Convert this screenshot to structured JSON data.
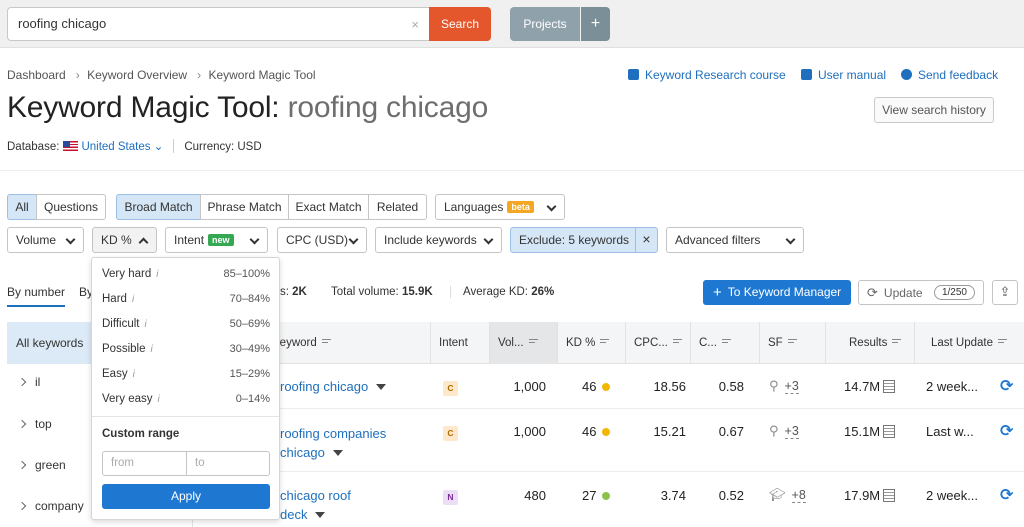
{
  "search": {
    "value": "roofing chicago",
    "clear": "×",
    "button": "Search"
  },
  "projects": {
    "label": "Projects",
    "plus": "+"
  },
  "breadcrumb": [
    "Dashboard",
    "Keyword Overview",
    "Keyword Magic Tool"
  ],
  "links": {
    "course": "Keyword Research course",
    "manual": "User manual",
    "feedback": "Send feedback"
  },
  "title": {
    "tool": "Keyword Magic Tool:",
    "keyword": "roofing chicago"
  },
  "history_button": "View search history",
  "database": {
    "label": "Database:",
    "country": "United States",
    "currency": "Currency: USD"
  },
  "filters_row1": {
    "all": "All",
    "questions": "Questions",
    "broad": "Broad Match",
    "phrase": "Phrase Match",
    "exact": "Exact Match",
    "related": "Related",
    "languages": "Languages",
    "beta": "beta"
  },
  "filters_row2": {
    "volume": "Volume",
    "kd": "KD %",
    "intent": "Intent",
    "new": "new",
    "cpc": "CPC (USD)",
    "include": "Include keywords",
    "exclude": "Exclude: 5 keywords",
    "exclude_x": "×",
    "advanced": "Advanced filters"
  },
  "tabs": {
    "by_number": "By number",
    "by_volume": "By"
  },
  "stats": {
    "keywords_label": "s:",
    "keywords_value": "2K",
    "volume_label": "Total volume:",
    "volume_value": "15.9K",
    "kd_label": "Average KD:",
    "kd_value": "26%"
  },
  "actions": {
    "to_km": "To Keyword Manager",
    "update": "Update",
    "update_count": "1/250"
  },
  "left_panel": {
    "header": "All keywords",
    "items": [
      "il",
      "top",
      "green",
      "company"
    ]
  },
  "table": {
    "columns": [
      "Keyword",
      "Intent",
      "Vol...",
      "KD %",
      "CPC...",
      "C...",
      "SF",
      "Results",
      "Last Update"
    ],
    "rows": [
      {
        "keyword": "roofing chicago",
        "intent": "C",
        "volume": "1,000",
        "kd": "46",
        "kd_color": "#f2b705",
        "cpc": "18.56",
        "com": "0.58",
        "sf_icon": "location-pin",
        "sf": "+3",
        "results": "14.7M",
        "updated": "2 week..."
      },
      {
        "keyword": "roofing companies chicago",
        "intent": "C",
        "volume": "1,000",
        "kd": "46",
        "kd_color": "#f2b705",
        "cpc": "15.21",
        "com": "0.67",
        "sf_icon": "location-pin",
        "sf": "+3",
        "results": "15.1M",
        "updated": "Last w..."
      },
      {
        "keyword": "chicago roof deck",
        "intent": "N",
        "volume": "480",
        "kd": "27",
        "kd_color": "#8bc34a",
        "cpc": "3.74",
        "com": "0.52",
        "sf_icon": "graduation-cap",
        "sf": "+8",
        "results": "17.9M",
        "updated": "2 week..."
      }
    ]
  },
  "kd_popup": {
    "items": [
      {
        "label": "Very hard",
        "range": "85–100%"
      },
      {
        "label": "Hard",
        "range": "70–84%"
      },
      {
        "label": "Difficult",
        "range": "50–69%"
      },
      {
        "label": "Possible",
        "range": "30–49%"
      },
      {
        "label": "Easy",
        "range": "15–29%"
      },
      {
        "label": "Very easy",
        "range": "0–14%"
      }
    ],
    "info": "i",
    "custom_title": "Custom range",
    "from_placeholder": "from",
    "to_placeholder": "to",
    "apply": "Apply"
  }
}
